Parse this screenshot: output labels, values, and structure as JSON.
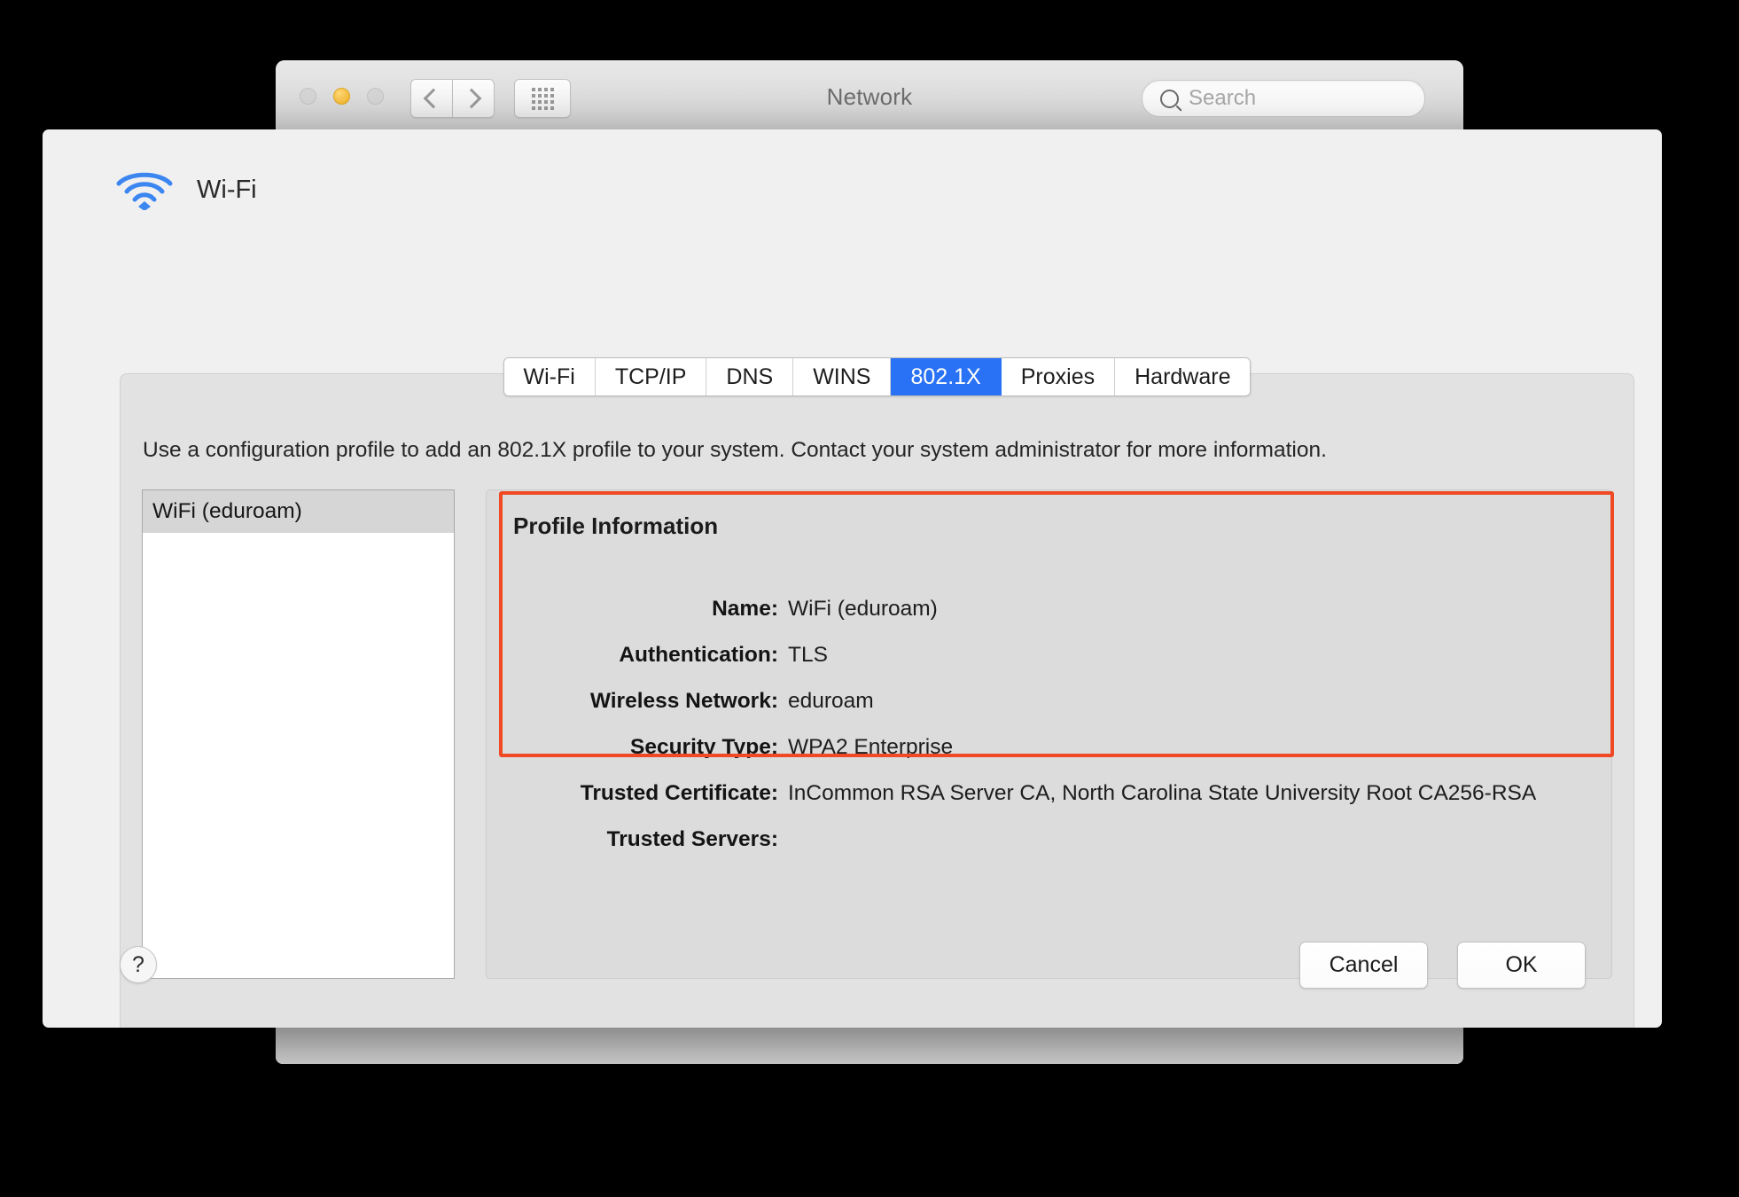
{
  "window": {
    "title": "Network",
    "traffic_lights": [
      "close",
      "minimize",
      "zoom"
    ],
    "nav": {
      "back": "back-chevron",
      "forward": "forward-chevron",
      "show_all": "grid-icon"
    },
    "search": {
      "placeholder": "Search",
      "icon": "search-icon"
    }
  },
  "sheet": {
    "icon": "wifi-icon",
    "header_label": "Wi-Fi",
    "tabs": [
      {
        "label": "Wi-Fi",
        "active": false
      },
      {
        "label": "TCP/IP",
        "active": false
      },
      {
        "label": "DNS",
        "active": false
      },
      {
        "label": "WINS",
        "active": false
      },
      {
        "label": "802.1X",
        "active": true
      },
      {
        "label": "Proxies",
        "active": false
      },
      {
        "label": "Hardware",
        "active": false
      }
    ],
    "description": "Use a configuration profile to add an 802.1X profile to your system. Contact your system administrator for more information.",
    "profile_list": [
      {
        "label": "WiFi (eduroam)",
        "selected": true
      }
    ],
    "detail": {
      "title": "Profile Information",
      "rows": [
        {
          "label": "Name:",
          "value": "WiFi (eduroam)"
        },
        {
          "label": "Authentication:",
          "value": "TLS"
        },
        {
          "label": "Wireless Network:",
          "value": "eduroam"
        },
        {
          "label": "Security Type:",
          "value": "WPA2 Enterprise"
        },
        {
          "label": "Trusted Certificate:",
          "value": "InCommon RSA Server CA, North Carolina State University Root CA256-RSA"
        },
        {
          "label": "Trusted Servers:",
          "value": ""
        }
      ]
    },
    "footer": {
      "help_label": "?",
      "cancel_label": "Cancel",
      "ok_label": "OK"
    }
  },
  "annotation": {
    "color": "#ef4a23"
  },
  "colors": {
    "accent_blue": "#2a72f5",
    "wifi_blue": "#3b86f0",
    "annotation_red": "#ef4a23",
    "amber": "#f6bd3a"
  }
}
